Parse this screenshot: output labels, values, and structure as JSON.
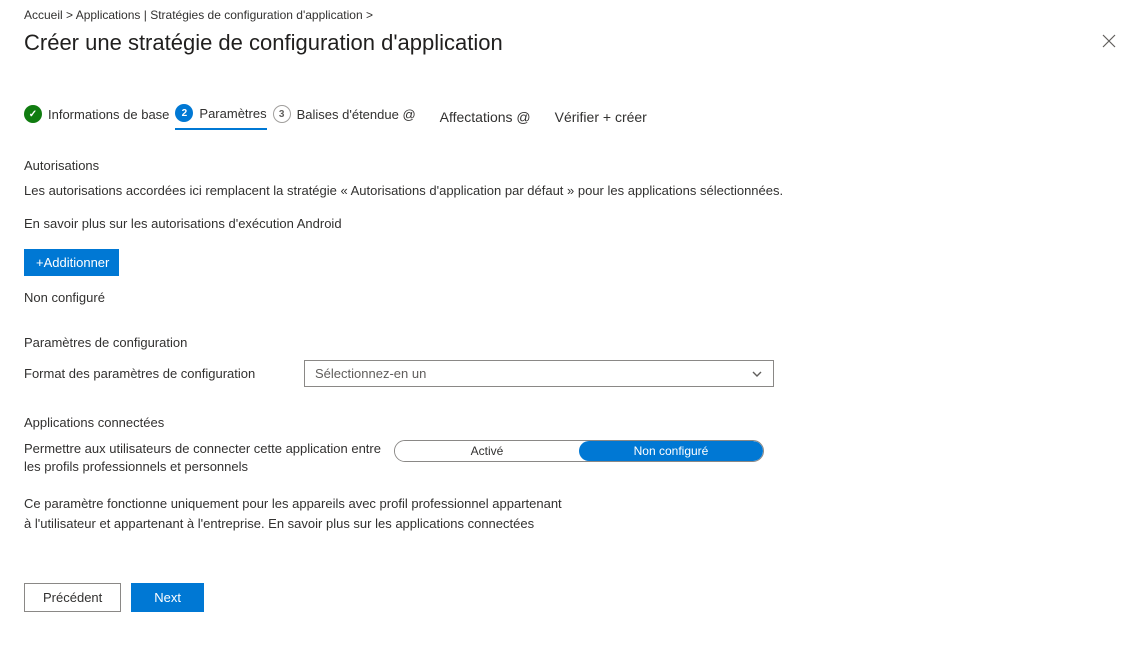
{
  "breadcrumb": "Accueil >  Applications | Stratégies de configuration d'application >",
  "title": "Créer une stratégie de configuration d'application",
  "steps": {
    "s1": {
      "label": "Informations de base"
    },
    "s2": {
      "num": "2",
      "label": "Paramètres"
    },
    "s3": {
      "num": "3",
      "label": "Balises d'étendue @"
    },
    "extra1": "Affectations @",
    "extra2": "Vérifier + créer"
  },
  "permissions": {
    "header": "Autorisations",
    "desc": "Les autorisations accordées ici remplacent la stratégie « Autorisations d'application par défaut » pour les applications sélectionnées.",
    "learn": "En savoir plus sur les autorisations d'exécution Android",
    "add": "+Additionner",
    "status": "Non configuré"
  },
  "config_settings": {
    "header": "Paramètres de configuration",
    "format_label": "Format des paramètres de configuration",
    "placeholder": "Sélectionnez-en un"
  },
  "connected": {
    "header": "Applications connectées",
    "label": "Permettre aux utilisateurs de connecter cette application entre les profils professionnels et personnels",
    "opt_on": "Activé",
    "opt_off": "Non configuré",
    "hint": "Ce paramètre fonctionne uniquement pour les appareils avec profil professionnel appartenant à l'utilisateur et appartenant à l'entreprise. En savoir plus sur les applications connectées"
  },
  "footer": {
    "prev": "Précédent",
    "next": "Next"
  }
}
